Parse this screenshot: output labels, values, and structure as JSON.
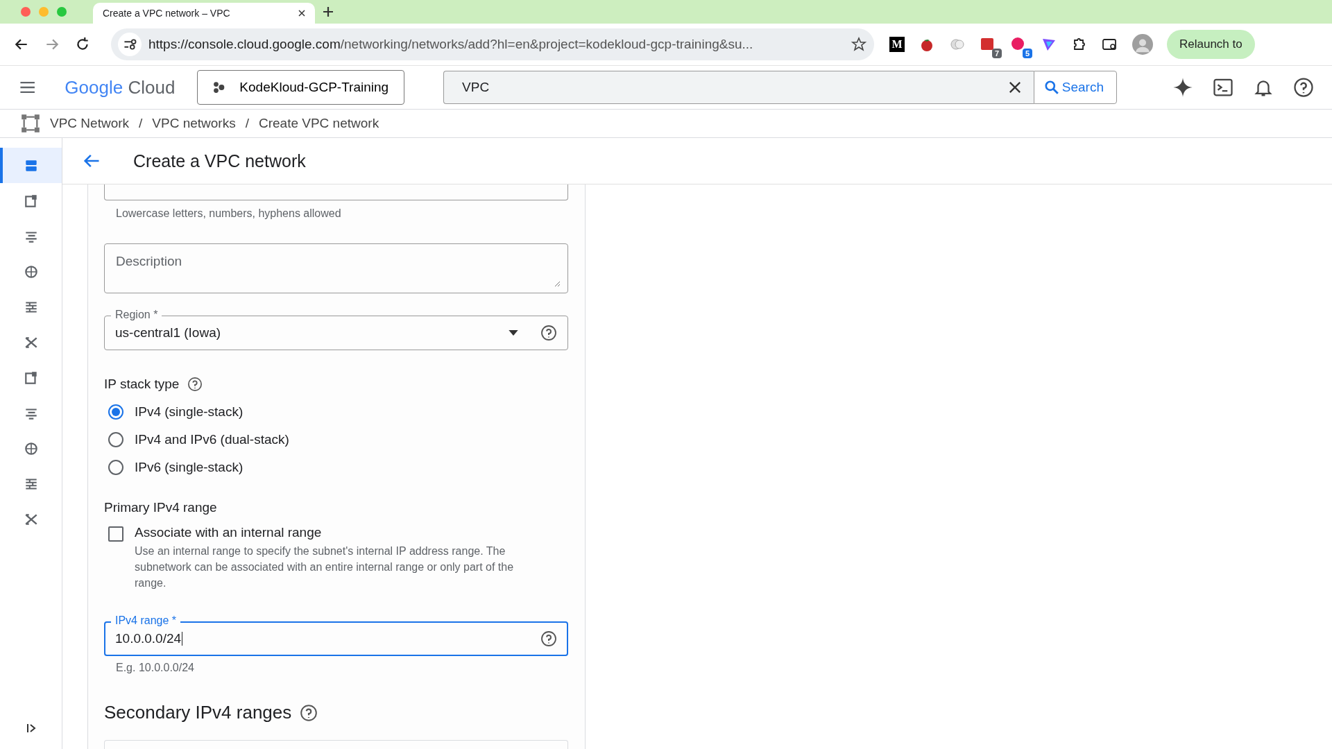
{
  "browser": {
    "tab_title": "Create a VPC network – VPC",
    "url_host": "https://console.cloud.google.com",
    "url_path": "/networking/networks/add?hl=en&project=kodekloud-gcp-training&su...",
    "extensions": [
      {
        "kind": "m",
        "label": "M"
      },
      {
        "kind": "tomato"
      },
      {
        "kind": "circles"
      },
      {
        "kind": "calendar",
        "badge": "7",
        "color": "#5f6368"
      },
      {
        "kind": "chat",
        "badge": "5",
        "color": "#1a73e8"
      },
      {
        "kind": "prism"
      },
      {
        "kind": "puzzle"
      }
    ],
    "relaunch": "Relaunch to"
  },
  "header": {
    "logo_google": "Google",
    "logo_cloud": "Cloud",
    "project": "KodeKloud-GCP-Training",
    "search_value": "VPC",
    "search_button": "Search"
  },
  "breadcrumb": [
    {
      "label": "VPC Network"
    },
    {
      "separator": "/",
      "label": "VPC networks"
    },
    {
      "separator": "/",
      "label": "Create VPC network"
    }
  ],
  "sidebar": {
    "items": [
      {
        "selected": true
      },
      {
        "selected": false
      },
      {
        "selected": false
      },
      {
        "selected": false
      },
      {
        "selected": false
      },
      {
        "selected": false
      },
      {
        "selected": false
      },
      {
        "selected": false
      },
      {
        "selected": false
      },
      {
        "selected": false
      },
      {
        "selected": false
      }
    ]
  },
  "page_title": "Create a VPC network",
  "form": {
    "name_hint": "Lowercase letters, numbers, hyphens allowed",
    "description_placeholder": "Description",
    "region_label": "Region *",
    "region_value": "us-central1 (Iowa)",
    "ip_stack_title": "IP stack type",
    "ip_stack_options": [
      {
        "label": "IPv4 (single-stack)",
        "selected": true
      },
      {
        "label": "IPv4 and IPv6 (dual-stack)",
        "selected": false
      },
      {
        "label": "IPv6 (single-stack)",
        "selected": false
      }
    ],
    "primary_title": "Primary IPv4 range",
    "associate": {
      "label": "Associate with an internal range",
      "checked": false,
      "help": "Use an internal range to specify the subnet's internal IP address range. The subnetwork can be associated with an entire internal range or only part of the range."
    },
    "ipv4_range": {
      "label": "IPv4 range *",
      "value": "10.0.0.0/24",
      "focused": true,
      "hint": "E.g. 10.0.0.0/24"
    },
    "secondary_title": "Secondary IPv4 ranges"
  }
}
